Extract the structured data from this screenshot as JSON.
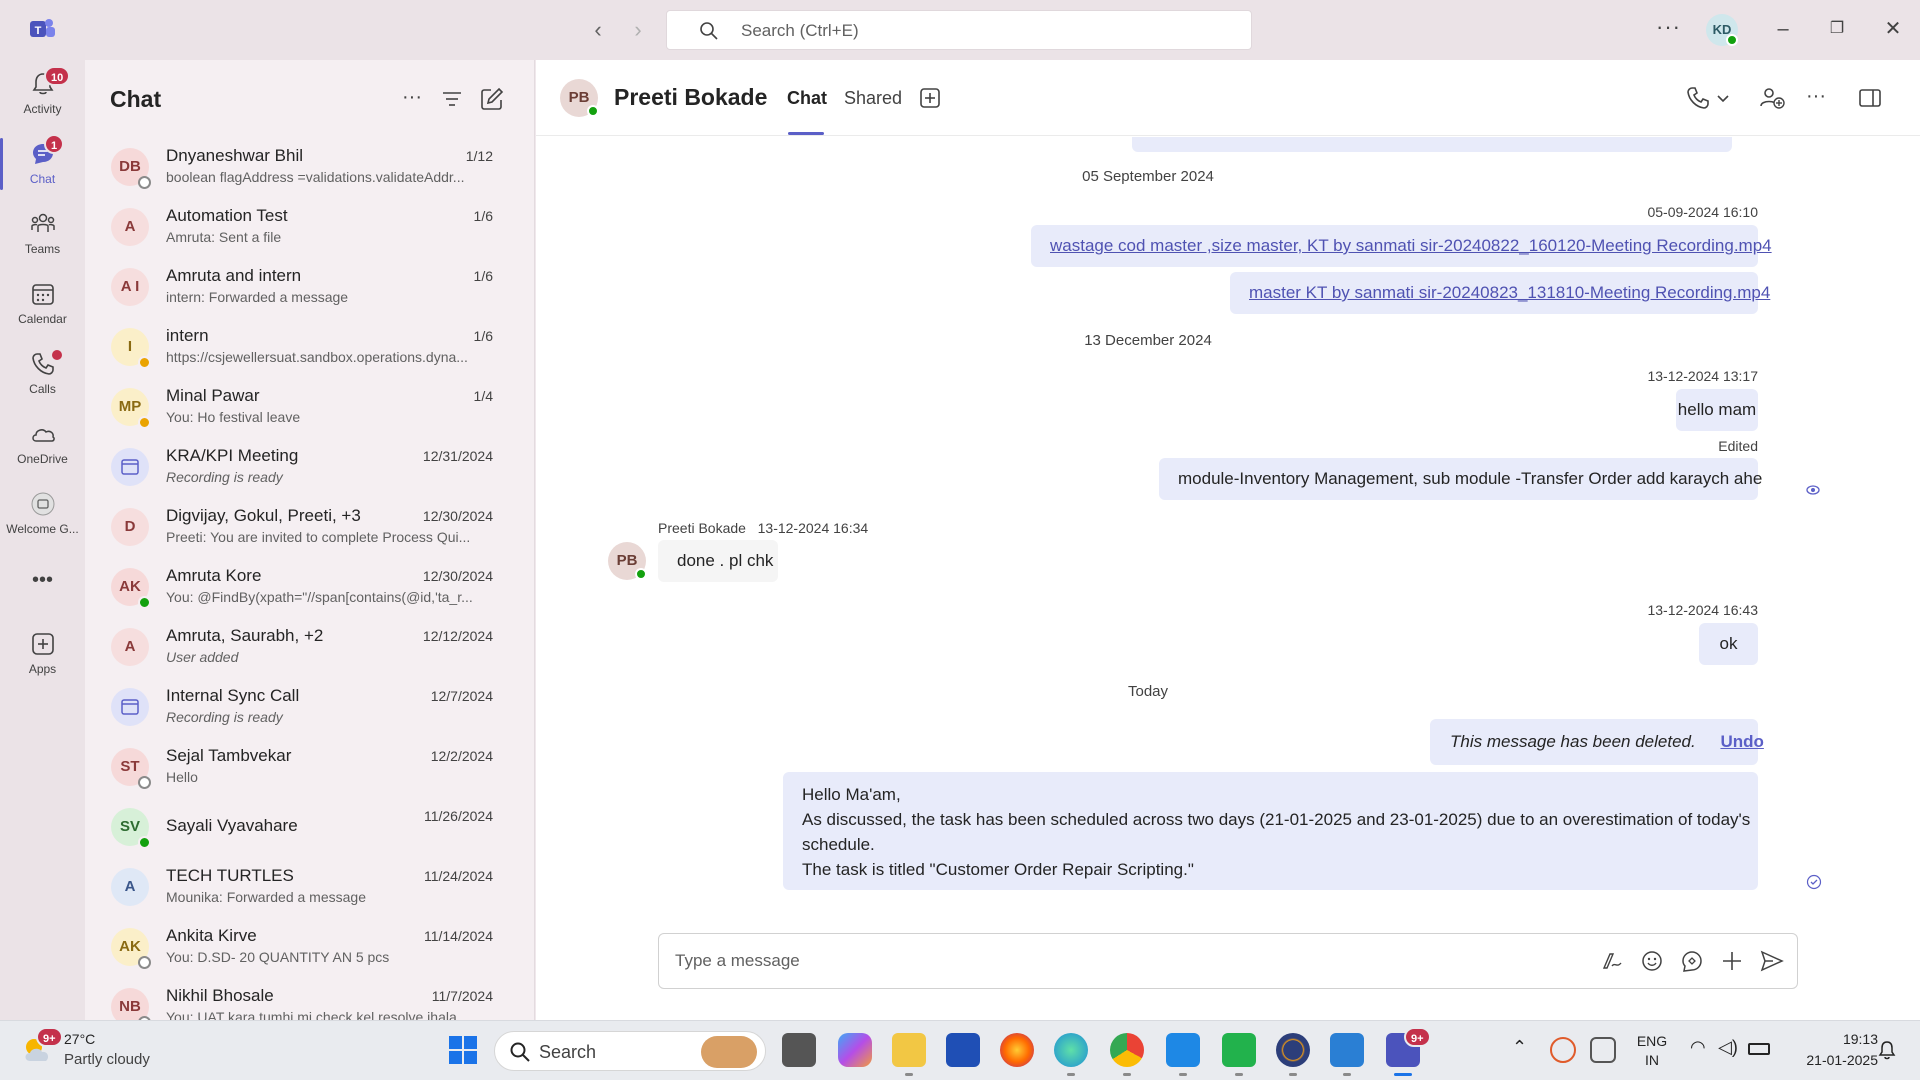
{
  "titlebar": {
    "search_placeholder": "Search (Ctrl+E)",
    "user_initials": "KD"
  },
  "rail": {
    "items": [
      {
        "label": "Activity",
        "badge": "10"
      },
      {
        "label": "Chat",
        "badge": "1"
      },
      {
        "label": "Teams"
      },
      {
        "label": "Calendar"
      },
      {
        "label": "Calls"
      },
      {
        "label": "OneDrive"
      },
      {
        "label": "Welcome G..."
      },
      {
        "label": "Apps"
      }
    ],
    "more": "•••"
  },
  "chatlist": {
    "title": "Chat",
    "items": [
      {
        "initials": "DB",
        "name": "Dnyaneshwar Bhil",
        "date": "1/12",
        "preview": "boolean flagAddress =validations.validateAddr...",
        "status": "offline",
        "bg": "#f6d9d9",
        "fg": "#8a3a3a"
      },
      {
        "initials": "A",
        "name": "Automation Test",
        "date": "1/6",
        "preview": "Amruta: Sent a file",
        "status": "group",
        "bg": "#f6dede",
        "fg": "#8a3a3a"
      },
      {
        "initials": "A  I",
        "name": "Amruta and intern",
        "date": "1/6",
        "preview": "intern: Forwarded a message",
        "status": "group",
        "bg": "#f6dede",
        "fg": "#8a3a3a"
      },
      {
        "initials": "I",
        "name": "intern",
        "date": "1/6",
        "preview": "https://csjewellersuat.sandbox.operations.dyna...",
        "status": "away",
        "bg": "#fbefc9",
        "fg": "#8a6a12"
      },
      {
        "initials": "MP",
        "name": "Minal Pawar",
        "date": "1/4",
        "preview": "You: Ho festival leave",
        "status": "away",
        "bg": "#fbefc9",
        "fg": "#8a6a12"
      },
      {
        "initials": "cal",
        "name": "KRA/KPI Meeting",
        "date": "12/31/2024",
        "preview": "Recording is ready",
        "status": "meeting",
        "italic": true,
        "bg": "#dfe2f8",
        "fg": "#5b5fc7"
      },
      {
        "initials": "D",
        "name": "Digvijay, Gokul, Preeti, +3",
        "date": "12/30/2024",
        "preview": "Preeti: You are invited to complete Process  Qui...",
        "status": "group",
        "bg": "#f6dede",
        "fg": "#8a3a3a"
      },
      {
        "initials": "AK",
        "name": "Amruta Kore",
        "date": "12/30/2024",
        "preview": "You: @FindBy(xpath=\"//span[contains(@id,'ta_r...",
        "status": "available",
        "bg": "#f6d9d9",
        "fg": "#8a3a3a"
      },
      {
        "initials": "A",
        "name": "Amruta, Saurabh, +2",
        "date": "12/12/2024",
        "preview": "User added",
        "status": "group",
        "italic": true,
        "bg": "#f6dede",
        "fg": "#8a3a3a"
      },
      {
        "initials": "cal",
        "name": "Internal Sync Call",
        "date": "12/7/2024",
        "preview": "Recording is ready",
        "status": "meeting",
        "italic": true,
        "bg": "#dfe2f8",
        "fg": "#5b5fc7"
      },
      {
        "initials": "ST",
        "name": "Sejal Tambvekar",
        "date": "12/2/2024",
        "preview": "Hello",
        "status": "offline",
        "bg": "#f6d9d9",
        "fg": "#8a3a3a"
      },
      {
        "initials": "SV",
        "name": "Sayali Vyavahare",
        "date": "11/26/2024",
        "preview": "",
        "status": "available",
        "bg": "#d7f0d8",
        "fg": "#2d6b30"
      },
      {
        "initials": "A",
        "name": "TECH TURTLES",
        "date": "11/24/2024",
        "preview": "Mounika: Forwarded a message",
        "status": "group",
        "bg": "#dfe8f6",
        "fg": "#3a568a"
      },
      {
        "initials": "AK",
        "name": "Ankita Kirve",
        "date": "11/14/2024",
        "preview": "You: D.SD- 20  QUANTITY AN 5 pcs",
        "status": "offline",
        "bg": "#fbefc9",
        "fg": "#8a6a12"
      },
      {
        "initials": "NB",
        "name": "Nikhil Bhosale",
        "date": "11/7/2024",
        "preview": "You: UAT kara tumhi mi check kel resolve jhala ...",
        "status": "offline",
        "bg": "#f6d9d9",
        "fg": "#8a3a3a"
      }
    ]
  },
  "chat": {
    "contact_initials": "PB",
    "contact_name": "Preeti Bokade",
    "tabs": [
      "Chat",
      "Shared"
    ],
    "date_sep_1": "05 September 2024",
    "stamp_1": "05-09-2024 16:10",
    "link_1": "wastage cod master ,size master, KT by sanmati sir-20240822_160120-Meeting Recording.mp4",
    "link_2": "master KT by sanmati sir-20240823_131810-Meeting Recording.mp4",
    "date_sep_2": "13 December 2024",
    "stamp_2": "13-12-2024 13:17",
    "msg_hello": "hello mam",
    "edited": "Edited",
    "msg_module": "module-Inventory Management, sub module -Transfer Order add karaych ahe",
    "them_sender": "Preeti Bokade",
    "them_time": "13-12-2024 16:34",
    "msg_done": "done . pl chk",
    "stamp_3": "13-12-2024 16:43",
    "msg_ok": "ok",
    "date_sep_3": "Today",
    "deleted_text": "This message has been deleted.",
    "undo": "Undo",
    "long_msg": [
      "Hello Ma'am,",
      "As discussed, the task has been scheduled across two days (21-01-2025 and 23-01-2025) due to an overestimation of today's",
      "schedule.",
      "The task is titled \"Customer Order Repair Scripting.\""
    ],
    "composer_placeholder": "Type a message"
  },
  "taskbar": {
    "weather_temp": "27°C",
    "weather_desc": "Partly cloudy",
    "weather_badge": "9+",
    "search_label": "Search",
    "lang_1": "ENG",
    "lang_2": "IN",
    "time": "19:13",
    "date": "21-01-2025",
    "teams_badge": "9+"
  }
}
